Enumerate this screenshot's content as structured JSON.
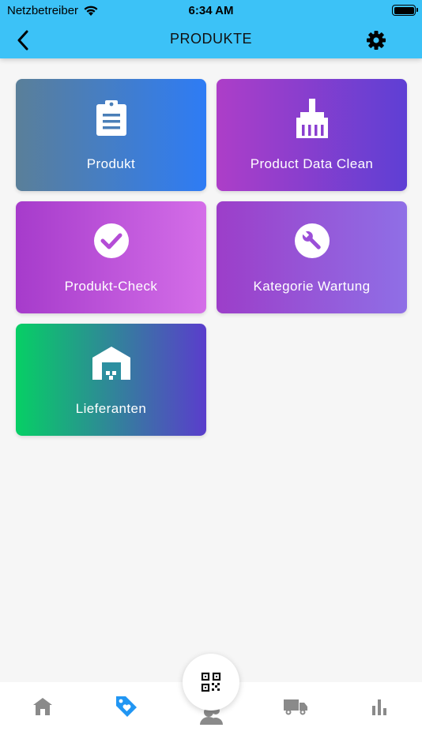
{
  "status": {
    "carrier": "Netzbetreiber",
    "time": "6:34 AM"
  },
  "header": {
    "title": "PRODUKTE"
  },
  "tiles": [
    {
      "label": "Produkt",
      "icon": "clipboard-icon"
    },
    {
      "label": "Product Data Clean",
      "icon": "broom-icon"
    },
    {
      "label": "Produkt-Check",
      "icon": "check-circle-icon"
    },
    {
      "label": "Kategorie Wartung",
      "icon": "wrench-icon"
    },
    {
      "label": "Lieferanten",
      "icon": "warehouse-icon"
    }
  ],
  "bottom_nav": {
    "tabs": [
      {
        "icon": "home-icon",
        "active": false
      },
      {
        "icon": "tag-heart-icon",
        "active": true
      },
      {
        "icon": "users-icon",
        "active": false
      },
      {
        "icon": "truck-icon",
        "active": false
      },
      {
        "icon": "bar-chart-icon",
        "active": false
      }
    ],
    "fab_icon": "qr-code-icon"
  },
  "colors": {
    "header": "#3cc2f7",
    "active_tab": "#2196f3",
    "inactive_tab": "#8a8a8a"
  }
}
